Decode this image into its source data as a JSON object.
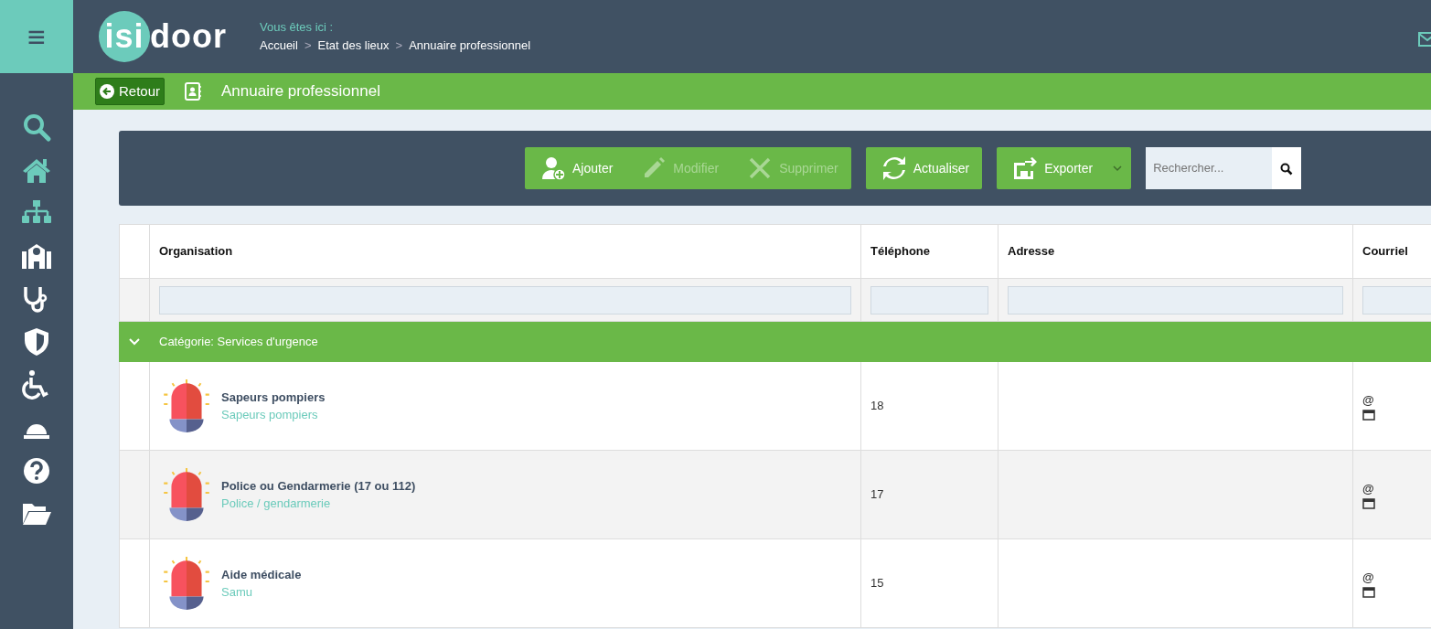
{
  "menu_button": {
    "glyph": "≡"
  },
  "logo": {
    "part_1": "isi",
    "part_2": "door"
  },
  "breadcrumb": {
    "label": "Vous êtes ici :",
    "items": [
      "Accueil",
      "Etat des lieux",
      "Annuaire professionnel"
    ],
    "separator": ">"
  },
  "sidebar": {
    "items": [
      {
        "accent": true
      },
      {
        "accent": true
      },
      {
        "accent": true
      },
      {
        "accent": false
      },
      {
        "accent": false
      },
      {
        "accent": false
      },
      {
        "accent": false
      },
      {
        "accent": false
      },
      {
        "accent": false
      },
      {
        "accent": false
      }
    ]
  },
  "title_bar": {
    "back_button": "Retour",
    "title": "Annuaire professionnel"
  },
  "toolbar": {
    "buttons": [
      {
        "label": "Ajouter",
        "disabled": false
      },
      {
        "label": "Modifier",
        "disabled": true
      },
      {
        "label": "Supprimer",
        "disabled": true
      },
      {
        "label": "Actualiser",
        "disabled": false
      },
      {
        "label": "Exporter",
        "disabled": false
      }
    ],
    "search": {
      "placeholder": "Rechercher..."
    }
  },
  "table": {
    "columns": [
      "Organisation",
      "Téléphone",
      "Adresse",
      "Courriel"
    ],
    "group": {
      "label": "Catégorie: Services d'urgence",
      "expanded": true
    },
    "rows": [
      {
        "name": "Sapeurs pompiers",
        "type": "Sapeurs pompiers",
        "phone": "18",
        "email": "@"
      },
      {
        "name": "Police ou Gendarmerie (17 ou 112)",
        "type": "Police / gendarmerie",
        "phone": "17",
        "email": "@"
      },
      {
        "name": "Aide médicale",
        "type": "Samu",
        "phone": "15",
        "email": "@"
      }
    ]
  }
}
